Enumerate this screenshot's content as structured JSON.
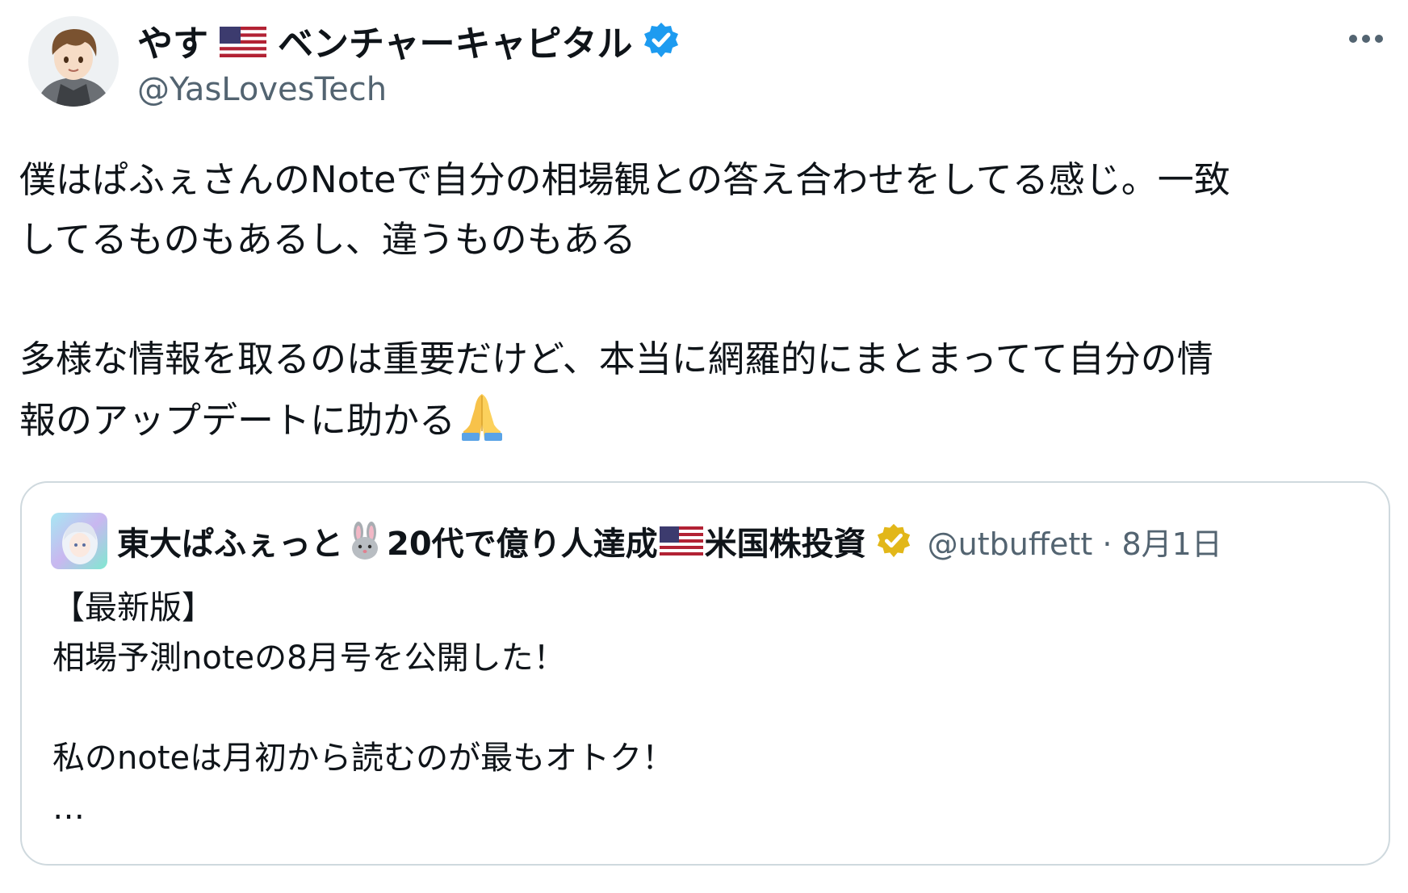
{
  "author": {
    "name_prefix": "やす",
    "name_suffix": "ベンチャーキャピタル",
    "handle": "@YasLovesTech",
    "avatar_icon": "anime-avatar-icon",
    "verified_icon": "blue-verified-badge-icon",
    "verified_color": "#1d9bf0"
  },
  "menu": {
    "more_icon": "more-horizontal-icon"
  },
  "tweet": {
    "line1": "僕はぱふぇさんのNoteで自分の相場観との答え合わせをしてる感じ。一致",
    "line2": "してるものもあるし、違うものもある",
    "line3": "多様な情報を取るのは重要だけど、本当に網羅的にまとまってて自分の情",
    "line4": "報のアップデートに助かる",
    "emoji": "folded-hands-icon"
  },
  "quote": {
    "name_part1": "東大ぱふぇっと",
    "name_part2": "20代で億り人達成",
    "name_part3": "米国株投資",
    "handle": "@utbuffett",
    "separator": "·",
    "date": "8月1日",
    "rabbit_icon": "rabbit-face-icon",
    "badge_icon": "gold-verified-badge-icon",
    "badge_color": "#e2b719",
    "body_line1": "【最新版】",
    "body_line2": "相場予測noteの8月号を公開した！",
    "body_line3": "私のnoteは月初から読むのが最もオトク！",
    "body_line4": "…"
  },
  "colors": {
    "text": "#0f1419",
    "secondary": "#536471",
    "border": "#cfd9de"
  }
}
